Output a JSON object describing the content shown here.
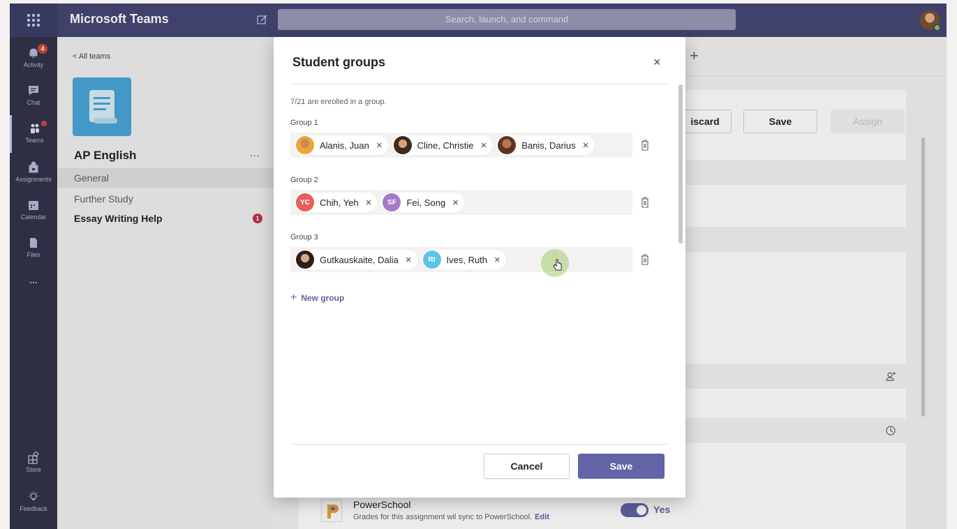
{
  "topbar": {
    "app_title": "Microsoft Teams",
    "search_placeholder": "Search, launch, and command"
  },
  "rail": {
    "items": [
      {
        "label": "Activity",
        "badge": "4"
      },
      {
        "label": "Chat"
      },
      {
        "label": "Teams"
      },
      {
        "label": "Assignments"
      },
      {
        "label": "Calendar"
      },
      {
        "label": "Files"
      },
      {
        "label": "..."
      }
    ],
    "bottom": [
      {
        "label": "Store"
      },
      {
        "label": "Feedback"
      }
    ]
  },
  "team_panel": {
    "back_link": "< All teams",
    "team_name": "AP English",
    "more": "...",
    "channels": [
      {
        "name": "General"
      },
      {
        "name": "Further Study"
      },
      {
        "name": "Essay Writing Help",
        "badge": "1"
      }
    ]
  },
  "background": {
    "discard_label": "iscard",
    "save_label": "Save",
    "assign_label": "Assign",
    "powerschool_title": "PowerSchool",
    "powerschool_sub": "Grades for this assignment wil sync to PowerSchool.",
    "powerschool_edit": "Edit",
    "toggle_label": "Yes"
  },
  "dialog": {
    "title": "Student groups",
    "close": "×",
    "enrolled_text": "7/21 are enrolled in a group.",
    "groups": [
      {
        "label": "Group 1",
        "members": [
          {
            "name": "Alanis, Juan"
          },
          {
            "name": "Cline, Christie"
          },
          {
            "name": "Banis, Darius"
          }
        ]
      },
      {
        "label": "Group 2",
        "members": [
          {
            "name": "Chih, Yeh",
            "initials": "YC",
            "color": "#e85d5d"
          },
          {
            "name": "Fei, Song",
            "initials": "SF",
            "color": "#a678c9"
          }
        ]
      },
      {
        "label": "Group 3",
        "members": [
          {
            "name": "Gutkauskaite, Dalia"
          },
          {
            "name": "Ives, Ruth",
            "initials": "RI",
            "color": "#5fc3e8"
          }
        ]
      }
    ],
    "remove_glyph": "×",
    "new_group_label": "New group",
    "cancel_label": "Cancel",
    "save_label": "Save"
  },
  "colors": {
    "brand": "#6264a7",
    "topbar": "#464775",
    "rail": "#33344a"
  }
}
